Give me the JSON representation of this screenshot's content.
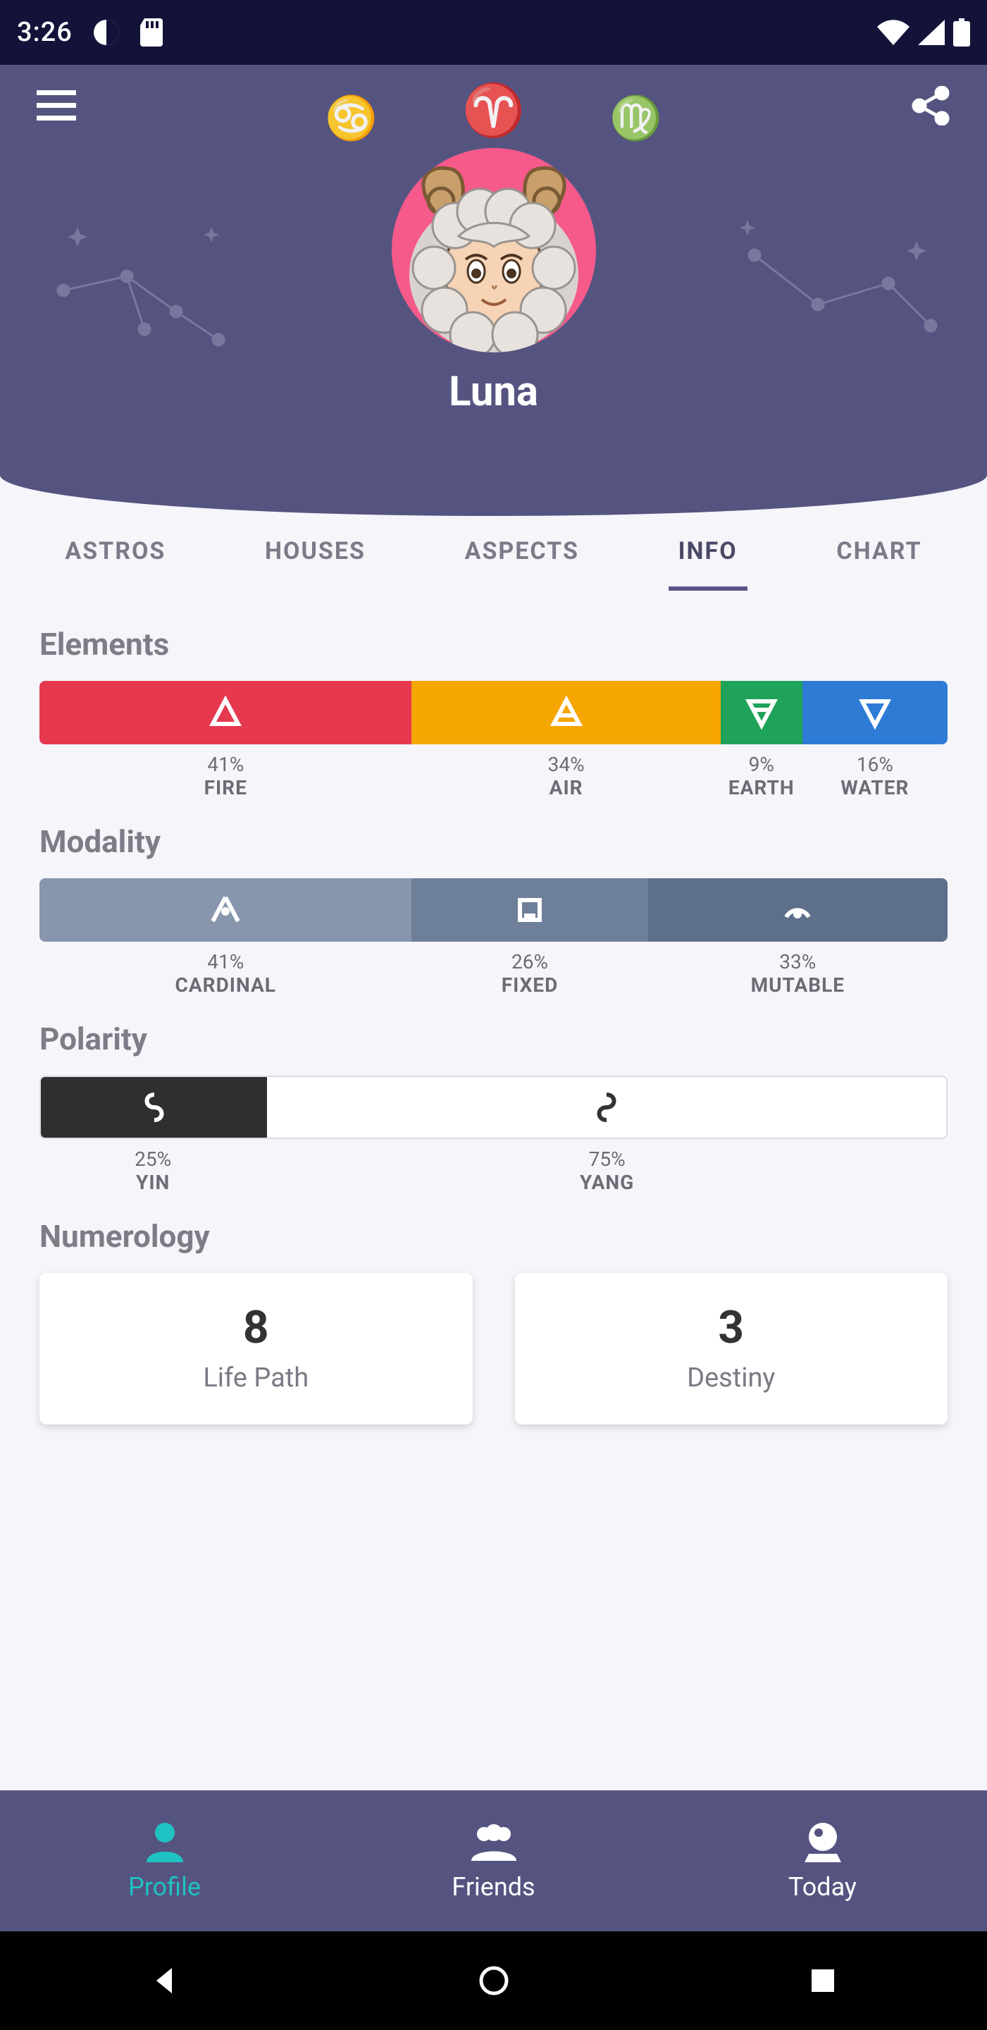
{
  "statusbar": {
    "time": "3:26"
  },
  "header": {
    "username": "Luna",
    "zodiac_left_icon": "cancer",
    "zodiac_center_icon": "aries",
    "zodiac_right_icon": "virgo"
  },
  "tabs": [
    {
      "label": "ASTROS",
      "active": false
    },
    {
      "label": "HOUSES",
      "active": false
    },
    {
      "label": "ASPECTS",
      "active": false
    },
    {
      "label": "INFO",
      "active": true
    },
    {
      "label": "CHART",
      "active": false
    }
  ],
  "sections": {
    "elements": {
      "title": "Elements",
      "items": [
        {
          "pct": "41%",
          "name": "FIRE",
          "width": 41,
          "color": "#e63950",
          "icon": "triangle-up"
        },
        {
          "pct": "34%",
          "name": "AIR",
          "width": 34,
          "color": "#f5a600",
          "icon": "triangle-up-bar"
        },
        {
          "pct": "9%",
          "name": "EARTH",
          "width": 9,
          "color": "#1fa35a",
          "icon": "triangle-down-bar"
        },
        {
          "pct": "16%",
          "name": "WATER",
          "width": 16,
          "color": "#2e7bd6",
          "icon": "triangle-down"
        }
      ]
    },
    "modality": {
      "title": "Modality",
      "items": [
        {
          "pct": "41%",
          "name": "CARDINAL",
          "width": 41,
          "color": "#8795ad",
          "icon": "cardinal"
        },
        {
          "pct": "26%",
          "name": "FIXED",
          "width": 26,
          "color": "#6e7f99",
          "icon": "fixed"
        },
        {
          "pct": "33%",
          "name": "MUTABLE",
          "width": 33,
          "color": "#5d6f8a",
          "icon": "mutable"
        }
      ]
    },
    "polarity": {
      "title": "Polarity",
      "items": [
        {
          "pct": "25%",
          "name": "YIN",
          "width": 25
        },
        {
          "pct": "75%",
          "name": "YANG",
          "width": 75
        }
      ]
    },
    "numerology": {
      "title": "Numerology",
      "cards": [
        {
          "value": "8",
          "caption": "Life Path"
        },
        {
          "value": "3",
          "caption": "Destiny"
        }
      ]
    }
  },
  "bottom_nav": [
    {
      "label": "Profile",
      "icon": "person",
      "active": true
    },
    {
      "label": "Friends",
      "icon": "people",
      "active": false
    },
    {
      "label": "Today",
      "icon": "crystal-ball",
      "active": false
    }
  ]
}
